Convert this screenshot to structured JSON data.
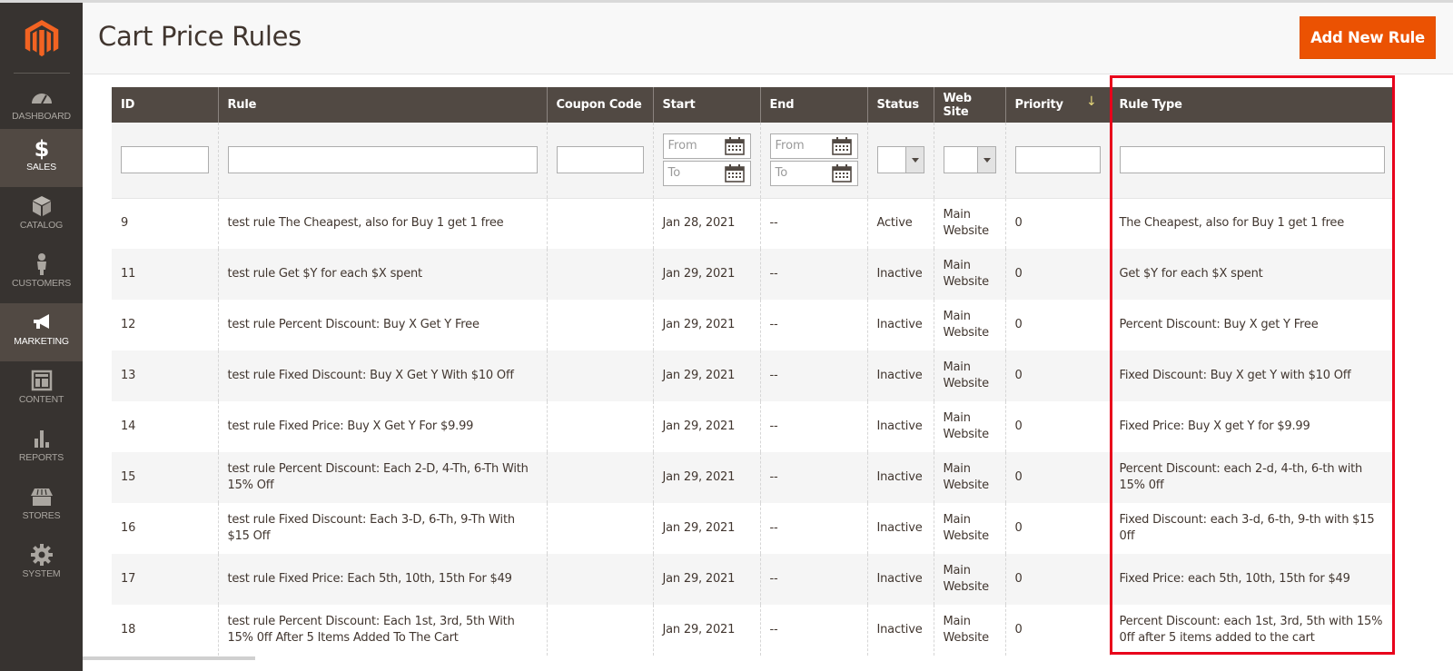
{
  "sidebar": {
    "logo": "magento-logo",
    "items": [
      {
        "label": "DASHBOARD",
        "icon": "dashboard-icon",
        "active": false
      },
      {
        "label": "SALES",
        "icon": "dollar-icon",
        "active": true
      },
      {
        "label": "CATALOG",
        "icon": "box-icon",
        "active": false
      },
      {
        "label": "CUSTOMERS",
        "icon": "person-icon",
        "active": false
      },
      {
        "label": "MARKETING",
        "icon": "megaphone-icon",
        "active": true
      },
      {
        "label": "CONTENT",
        "icon": "layout-icon",
        "active": false
      },
      {
        "label": "REPORTS",
        "icon": "bar-chart-icon",
        "active": false
      },
      {
        "label": "STORES",
        "icon": "storefront-icon",
        "active": false
      },
      {
        "label": "SYSTEM",
        "icon": "gear-icon",
        "active": false
      }
    ]
  },
  "header": {
    "title": "Cart Price Rules",
    "add_button": "Add New Rule"
  },
  "colors": {
    "accent": "#eb5202",
    "sidebar_bg": "#373330",
    "table_header_bg": "#514943",
    "highlight": "#e8001b"
  },
  "grid": {
    "columns": [
      "ID",
      "Rule",
      "Coupon Code",
      "Start",
      "End",
      "Status",
      "Web Site",
      "Priority",
      "Rule Type"
    ],
    "sorted_column": "Priority",
    "sort_direction": "descending",
    "filters": {
      "id": "",
      "rule": "",
      "coupon": "",
      "start_from_placeholder": "From",
      "start_to_placeholder": "To",
      "end_from_placeholder": "From",
      "end_to_placeholder": "To",
      "status": "",
      "website": "",
      "priority": "",
      "rule_type": ""
    },
    "rows": [
      {
        "id": "9",
        "rule": "test rule The Cheapest, also for Buy 1 get 1 free",
        "coupon": "",
        "start": "Jan 28, 2021",
        "end": "--",
        "status": "Active",
        "website": "Main Website",
        "priority": "0",
        "rule_type": "The Cheapest, also for Buy 1 get 1 free"
      },
      {
        "id": "11",
        "rule": "test rule Get $Y for each $X spent",
        "coupon": "",
        "start": "Jan 29, 2021",
        "end": "--",
        "status": "Inactive",
        "website": "Main Website",
        "priority": "0",
        "rule_type": "Get $Y for each $X spent"
      },
      {
        "id": "12",
        "rule": "test rule Percent Discount: Buy X Get Y Free",
        "coupon": "",
        "start": "Jan 29, 2021",
        "end": "--",
        "status": "Inactive",
        "website": "Main Website",
        "priority": "0",
        "rule_type": "Percent Discount: Buy X get Y Free"
      },
      {
        "id": "13",
        "rule": "test rule Fixed Discount: Buy X Get Y With $10 Off",
        "coupon": "",
        "start": "Jan 29, 2021",
        "end": "--",
        "status": "Inactive",
        "website": "Main Website",
        "priority": "0",
        "rule_type": "Fixed Discount: Buy X get Y with $10 Off"
      },
      {
        "id": "14",
        "rule": "test rule Fixed Price: Buy X Get Y For $9.99",
        "coupon": "",
        "start": "Jan 29, 2021",
        "end": "--",
        "status": "Inactive",
        "website": "Main Website",
        "priority": "0",
        "rule_type": "Fixed Price: Buy X get Y for $9.99"
      },
      {
        "id": "15",
        "rule": "test rule Percent Discount: Each 2-D, 4-Th, 6-Th With 15% Off",
        "coupon": "",
        "start": "Jan 29, 2021",
        "end": "--",
        "status": "Inactive",
        "website": "Main Website",
        "priority": "0",
        "rule_type": "Percent Discount: each 2-d, 4-th, 6-th with 15% 0ff"
      },
      {
        "id": "16",
        "rule": "test rule Fixed Discount: Each 3-D, 6-Th, 9-Th With $15 Off",
        "coupon": "",
        "start": "Jan 29, 2021",
        "end": "--",
        "status": "Inactive",
        "website": "Main Website",
        "priority": "0",
        "rule_type": "Fixed Discount: each 3-d, 6-th, 9-th with $15 0ff"
      },
      {
        "id": "17",
        "rule": "test rule Fixed Price: Each 5th, 10th, 15th For $49",
        "coupon": "",
        "start": "Jan 29, 2021",
        "end": "--",
        "status": "Inactive",
        "website": "Main Website",
        "priority": "0",
        "rule_type": "Fixed Price: each 5th, 10th, 15th for $49"
      },
      {
        "id": "18",
        "rule": "test rule Percent Discount: Each 1st, 3rd, 5th With 15% 0ff After 5 Items Added To The Cart",
        "coupon": "",
        "start": "Jan 29, 2021",
        "end": "--",
        "status": "Inactive",
        "website": "Main Website",
        "priority": "0",
        "rule_type": "Percent Discount: each 1st, 3rd, 5th with 15% 0ff after 5 items added to the cart"
      }
    ]
  }
}
